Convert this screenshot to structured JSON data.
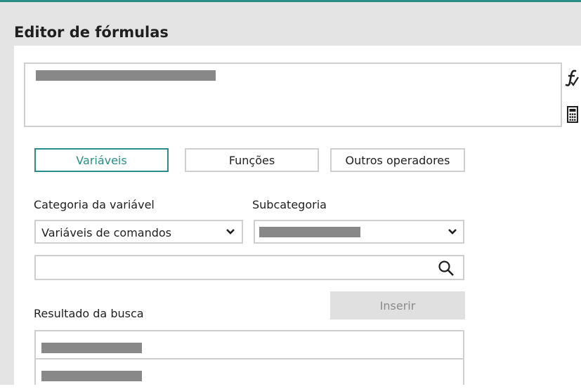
{
  "editor": {
    "title": "Editor de fórmulas",
    "formula_value": "",
    "side_icons": [
      "function-icon",
      "calculator-icon"
    ]
  },
  "tabs": [
    {
      "label": "Variáveis",
      "active": true
    },
    {
      "label": "Funções",
      "active": false
    },
    {
      "label": "Outros operadores",
      "active": false
    }
  ],
  "filters": {
    "category_label": "Categoria da variável",
    "category_value": "Variáveis de comandos",
    "subcategory_label": "Subcategoria",
    "subcategory_value": ""
  },
  "search": {
    "placeholder": "",
    "value": "",
    "icon": "search-icon"
  },
  "actions": {
    "insert_label": "Inserir"
  },
  "results": {
    "label": "Resultado da busca",
    "items": [
      "",
      ""
    ]
  },
  "colors": {
    "accent": "#2a8c86",
    "header_bg": "#e4e4e4",
    "border": "#cfcfcf",
    "redaction": "#888888",
    "disabled_button_bg": "#e0e0e0"
  }
}
